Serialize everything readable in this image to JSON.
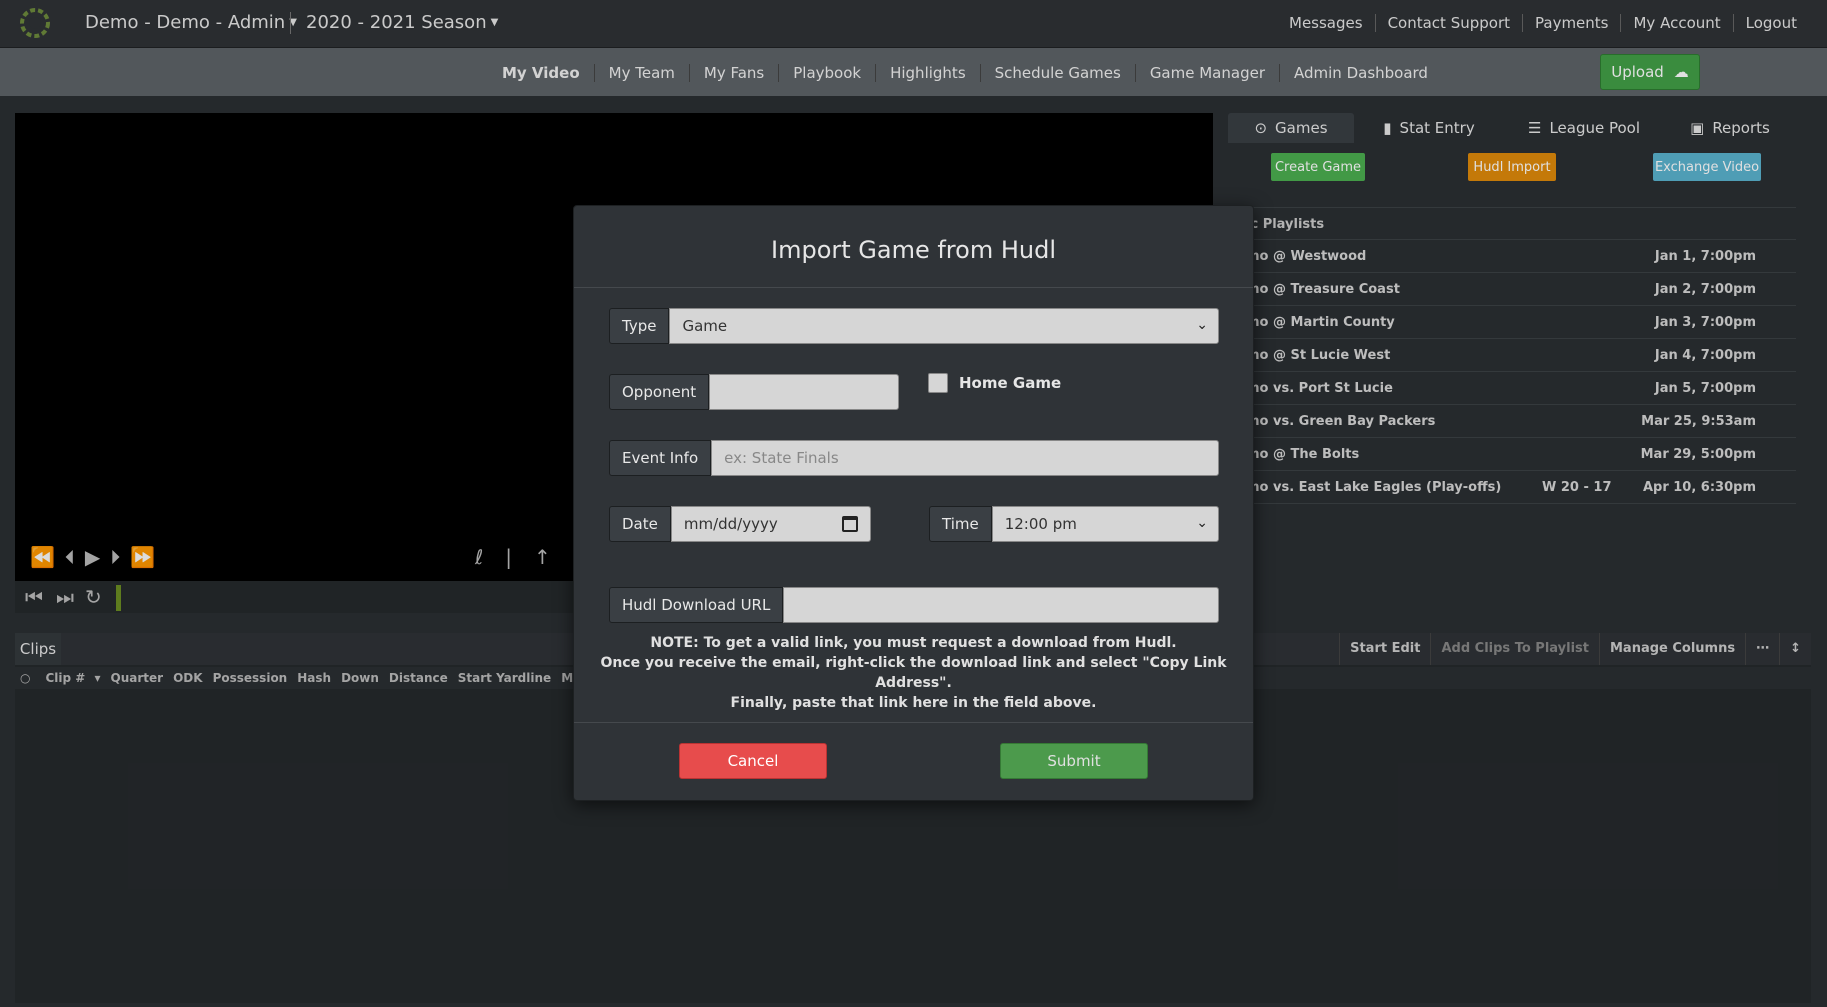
{
  "header": {
    "org": "Demo - Demo - Admin",
    "season": "2020 - 2021 Season",
    "links": [
      "Messages",
      "Contact Support",
      "Payments",
      "My Account",
      "Logout"
    ]
  },
  "nav": {
    "items": [
      "My Video",
      "My Team",
      "My Fans",
      "Playbook",
      "Highlights",
      "Schedule Games",
      "Game Manager",
      "Admin Dashboard"
    ],
    "upload": "Upload"
  },
  "panel": {
    "tabs": [
      "Games",
      "Stat Entry",
      "League Pool",
      "Reports"
    ],
    "buttons": {
      "create": "Create Game",
      "hudl": "Hudl Import",
      "exchange": "Exchange Video"
    },
    "section": "ic Playlists",
    "games": [
      {
        "name": "mo @ Westwood",
        "result": "",
        "date": "Jan 1, 7:00pm"
      },
      {
        "name": "mo @ Treasure Coast",
        "result": "",
        "date": "Jan 2, 7:00pm"
      },
      {
        "name": "mo @ Martin County",
        "result": "",
        "date": "Jan 3, 7:00pm"
      },
      {
        "name": "mo @ St Lucie West",
        "result": "",
        "date": "Jan 4, 7:00pm"
      },
      {
        "name": "mo vs. Port St Lucie",
        "result": "",
        "date": "Jan 5, 7:00pm"
      },
      {
        "name": "mo vs. Green Bay Packers",
        "result": "",
        "date": "Mar 25, 9:53am"
      },
      {
        "name": "mo @ The Bolts",
        "result": "",
        "date": "Mar 29, 5:00pm"
      },
      {
        "name": "mo vs. East Lake Eagles (Play-offs)",
        "result": "W 20 - 17",
        "date": "Apr 10, 6:30pm"
      }
    ]
  },
  "clips": {
    "tab": "Clips",
    "actions": [
      "Start Edit",
      "Add Clips To Playlist",
      "Manage Columns",
      "⋯",
      "↕"
    ],
    "columns": [
      "Clip #",
      "Quarter",
      "ODK",
      "Possession",
      "Hash",
      "Down",
      "Distance",
      "Start Yardline",
      "Motion Dir"
    ]
  },
  "modal": {
    "title": "Import Game from Hudl",
    "type_label": "Type",
    "type_value": "Game",
    "opponent_label": "Opponent",
    "opponent_value": "",
    "home_game_label": "Home Game",
    "event_label": "Event Info",
    "event_placeholder": "ex: State Finals",
    "date_label": "Date",
    "date_placeholder": "mm/dd/yyyy",
    "time_label": "Time",
    "time_value": "12:00 pm",
    "url_label": "Hudl Download URL",
    "url_value": "",
    "note": [
      "NOTE: To get a valid link, you must request a download from Hudl.",
      "Once you receive the email, right-click the download link and select \"Copy Link Address\".",
      "Finally, paste that link here in the field above."
    ],
    "cancel": "Cancel",
    "submit": "Submit"
  }
}
